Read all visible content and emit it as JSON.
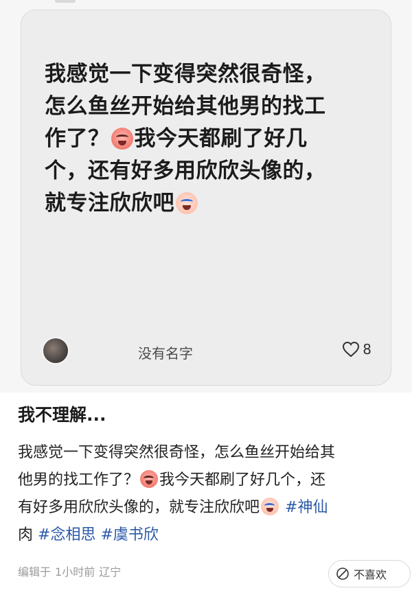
{
  "card": {
    "lines": [
      "我感觉一下变得突然很奇怪，",
      "怎么鱼丝开始给其他男的找工",
      "作了？",
      "我今天都刷了好几",
      "个，还有好多用欣欣头像的，",
      "就专注欣欣吧"
    ],
    "author": "没有名字",
    "likes": "8"
  },
  "post": {
    "title": "我不理解...",
    "body_lines": [
      "我感觉一下变得突然很奇怪，怎么鱼丝开始给其",
      "他男的找工作了？",
      "我今天都刷了好几个，还",
      "有好多用欣欣头像的，就专注欣欣吧",
      "肉"
    ],
    "tags": [
      "#神仙",
      "#念相思",
      "#虞书欣"
    ],
    "meta": {
      "edited": "编辑于",
      "time": "1小时前",
      "location": "辽宁"
    },
    "dislike_label": "不喜欢"
  },
  "icons": [
    "loudly-crying-face-emoji",
    "crying-face-emoji",
    "heart-outline-icon",
    "dislike-icon"
  ]
}
